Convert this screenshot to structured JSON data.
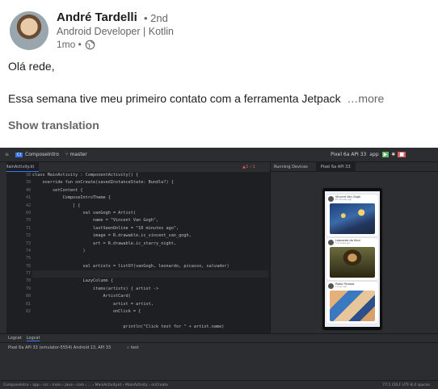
{
  "post": {
    "author": "André Tardelli",
    "degree": "• 2nd",
    "headline": "Android Developer | Kotlin",
    "time": "1mo •",
    "line1": "Olá rede,",
    "line2": "Essa semana tive meu primeiro contato com a ferramenta Jetpack",
    "more": "…more",
    "translate": "Show translation"
  },
  "ide": {
    "project": "ComposeIntro",
    "branch": "master",
    "run_config": "app",
    "device": "Pixel 6a API 33",
    "file_tab": "MainActivity.kt",
    "running_devices": "Running Devices",
    "device_tab": "Pixel 6a API 33",
    "warnings": "▲3 ✓1",
    "line_numbers": [
      "38",
      "39",
      "40",
      "41",
      "42",
      "69",
      "70",
      "71",
      "72",
      "73",
      "74",
      "75",
      "76",
      "77",
      "78",
      "79",
      "80",
      "81",
      "82"
    ],
    "code": [
      "class MainActivity : ComponentActivity() {",
      "    override fun onCreate(savedInstanceState: Bundle?) {",
      "        setContent {",
      "            ComposeIntroTheme {",
      "                ] {",
      "                    val vanGogh = Artist(",
      "                        name = \"Vincent Van Gogh\",",
      "                        lastSeenOnline = \"10 minutes ago\",",
      "                        image = R.drawable.ic_vincent_van_gogh,",
      "                        art = R.drawable.ic_starry_night,",
      "                    )",
      "",
      "                    val artists = listOf(vanGogh, leonardo, picasso, salvador)",
      "",
      "                    LazyColumn {",
      "                        items(artists) { artist ->",
      "                            ArtistCard(",
      "                                artist = artist,",
      "                                onClick = {"
    ],
    "last_line": "                                    println(\"Click test for \" + artist.name)",
    "cards": [
      {
        "name": "Vincent Van Gogh",
        "time": "10 minutes ago"
      },
      {
        "name": "Leonardo da Vinci",
        "time": "5 minutes ago"
      },
      {
        "name": "Pablo Picasso",
        "time": "1 hour ago"
      }
    ],
    "logcat_tabs": [
      "Logcat",
      "Logcat"
    ],
    "logcat_device": "Pixel 6a API 33 (emulator-5554) Android 13, API 33",
    "logcat_filter": "test",
    "status_path": "ComposeIntro › app › src › main › java › com › ... › MainActivity.kt › MainActivity › onCreate",
    "status_right": "77:1   CRLF   UTF-8   4 spaces"
  }
}
